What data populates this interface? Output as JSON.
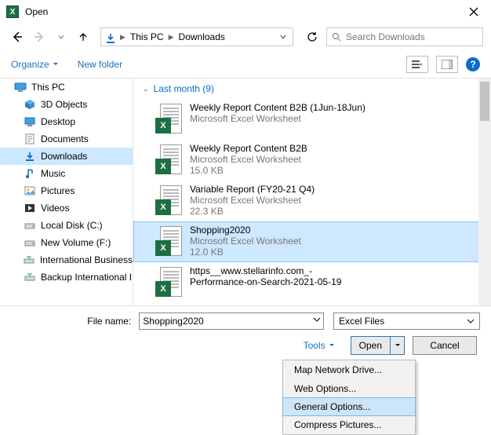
{
  "window": {
    "title": "Open"
  },
  "nav": {
    "crumb1": "This PC",
    "crumb2": "Downloads",
    "search_placeholder": "Search Downloads"
  },
  "toolbar": {
    "organize": "Organize",
    "newfolder": "New folder"
  },
  "sidebar": {
    "thispc": "This PC",
    "objects3d": "3D Objects",
    "desktop": "Desktop",
    "documents": "Documents",
    "downloads": "Downloads",
    "music": "Music",
    "pictures": "Pictures",
    "videos": "Videos",
    "localc": "Local Disk (C:)",
    "newvolf": "New Volume (F:)",
    "intlbiz": "International Business",
    "backupintl": "Backup International I"
  },
  "group": {
    "label": "Last month (9)"
  },
  "files": [
    {
      "name": "Weekly Report Content B2B (1Jun-18Jun)",
      "type": "Microsoft Excel Worksheet",
      "size": ""
    },
    {
      "name": "Weekly Report Content B2B",
      "type": "Microsoft Excel Worksheet",
      "size": "15.0 KB"
    },
    {
      "name": "Variable Report (FY20-21 Q4)",
      "type": "Microsoft Excel Worksheet",
      "size": "22.3 KB"
    },
    {
      "name": "Shopping2020",
      "type": "Microsoft Excel Worksheet",
      "size": "12.0 KB"
    },
    {
      "name": "https__www.stellarinfo.com_-Performance-on-Search-2021-05-19",
      "type": "",
      "size": ""
    }
  ],
  "footer": {
    "filename_label": "File name:",
    "filename_value": "Shopping2020",
    "filter": "Excel Files",
    "tools": "Tools",
    "open": "Open",
    "cancel": "Cancel"
  },
  "menu": {
    "m1": "Map Network Drive...",
    "m2": "Web Options...",
    "m3": "General Options...",
    "m4": "Compress Pictures..."
  }
}
